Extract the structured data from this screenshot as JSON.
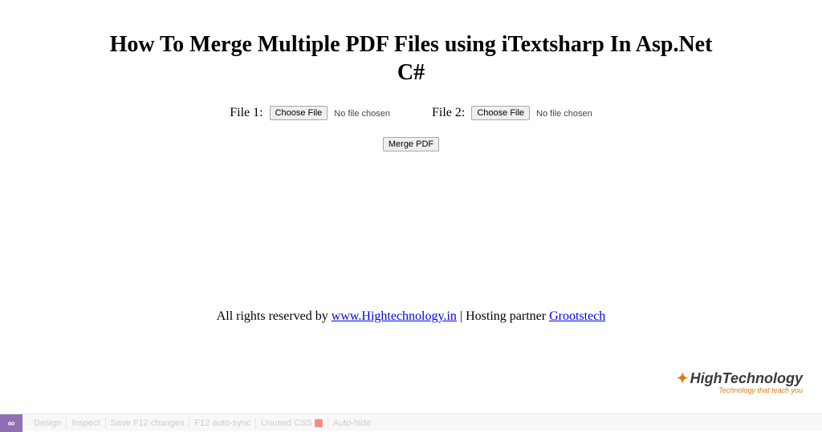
{
  "title": "How To Merge Multiple PDF Files using iTextsharp In Asp.Net C#",
  "form": {
    "file1": {
      "label": "File 1:",
      "button": "Choose File",
      "status": "No file chosen"
    },
    "file2": {
      "label": "File 2:",
      "button": "Choose File",
      "status": "No file chosen"
    },
    "merge_button": "Merge PDF"
  },
  "footer": {
    "prefix": "All rights reserved by ",
    "link1_text": "www.Hightechnology.in",
    "separator": " | Hosting partner ",
    "link2_text": "Grootstech"
  },
  "brand": {
    "icon": "✦",
    "name": "HighTechnology",
    "tagline": "Technology that teach you"
  },
  "toolbar": {
    "vs": "∞",
    "design": "Design",
    "inspect": "Inspect",
    "save": "Save F12 changes",
    "autosync": "F12 auto-sync",
    "unused": "Unused CSS",
    "autohide": "Auto-hide"
  }
}
